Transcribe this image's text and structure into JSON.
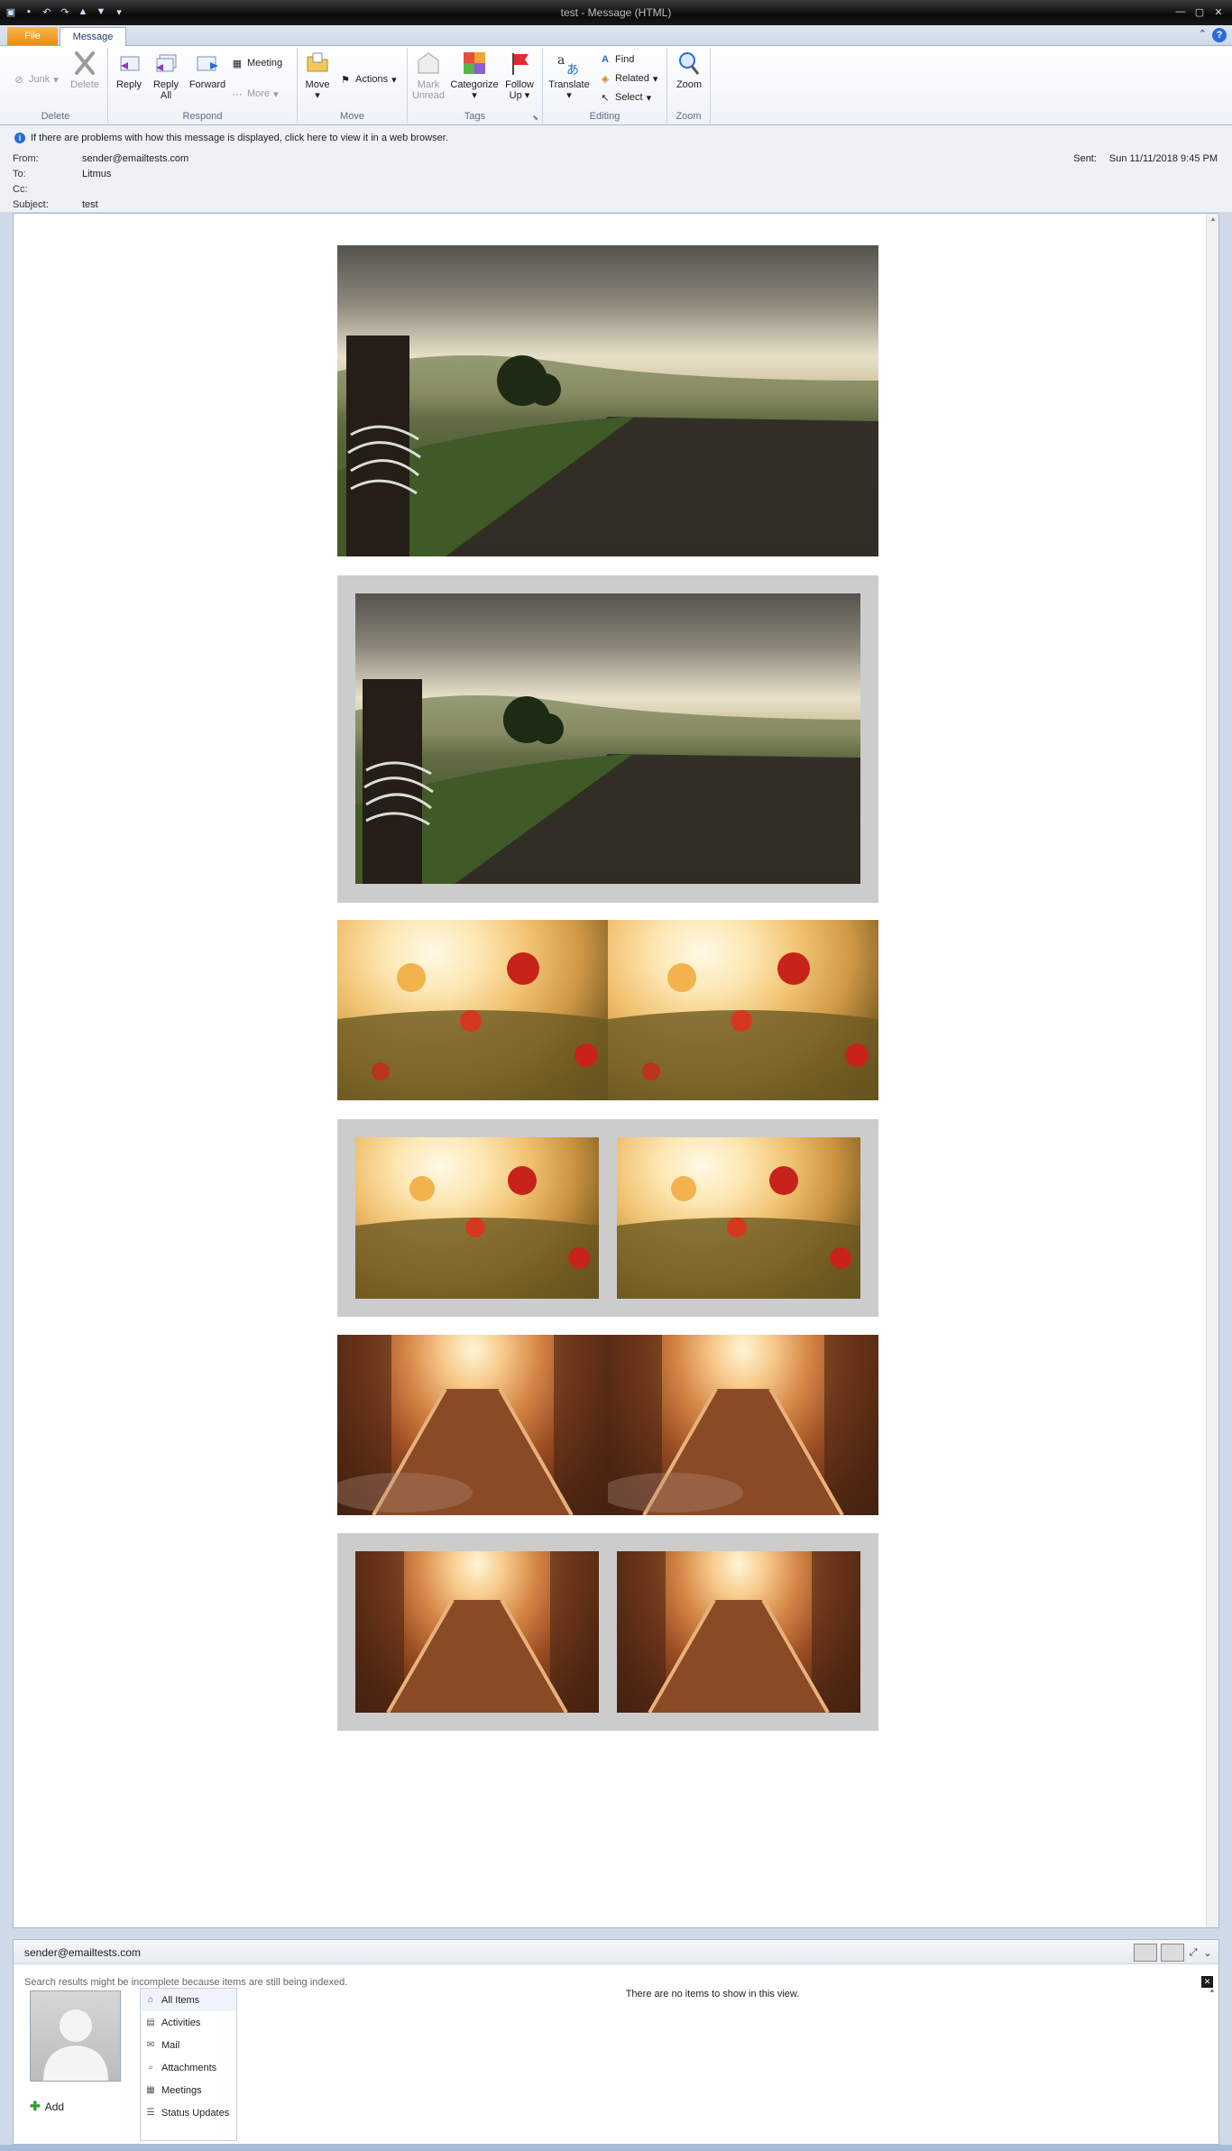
{
  "window": {
    "title": "test - Message (HTML)",
    "qat_icons": [
      "outlook-icon",
      "save-icon",
      "undo-icon",
      "redo-icon",
      "up-icon",
      "down-icon",
      "customize-icon"
    ]
  },
  "tabs": {
    "file": "File",
    "message": "Message"
  },
  "ribbon": {
    "delete_group": {
      "label": "Delete",
      "junk": "Junk",
      "delete": "Delete"
    },
    "respond_group": {
      "label": "Respond",
      "reply": "Reply",
      "reply_all_1": "Reply",
      "reply_all_2": "All",
      "forward": "Forward",
      "meeting": "Meeting",
      "more": "More"
    },
    "move_group": {
      "label": "Move",
      "move": "Move",
      "actions": "Actions"
    },
    "tags_group": {
      "label": "Tags",
      "mark_unread_1": "Mark",
      "mark_unread_2": "Unread",
      "categorize": "Categorize",
      "follow_up_1": "Follow",
      "follow_up_2": "Up"
    },
    "editing_group": {
      "label": "Editing",
      "translate": "Translate",
      "find": "Find",
      "related": "Related",
      "select": "Select"
    },
    "zoom_group": {
      "label": "Zoom",
      "zoom": "Zoom"
    }
  },
  "message": {
    "notice": "If there are problems with how this message is displayed, click here to view it in a web browser.",
    "from_label": "From:",
    "from": "sender@emailtests.com",
    "to_label": "To:",
    "to": "Litmus",
    "cc_label": "Cc:",
    "cc": "",
    "subject_label": "Subject:",
    "subject": "test",
    "sent_label": "Sent:",
    "sent": "Sun 11/11/2018 9:45 PM"
  },
  "people_pane": {
    "name": "sender@emailtests.com",
    "warning": "Search results might be incomplete because items are still being indexed.",
    "add": "Add",
    "categories": [
      "All Items",
      "Activities",
      "Mail",
      "Attachments",
      "Meetings",
      "Status Updates"
    ],
    "empty": "There are no items to show in this view."
  }
}
